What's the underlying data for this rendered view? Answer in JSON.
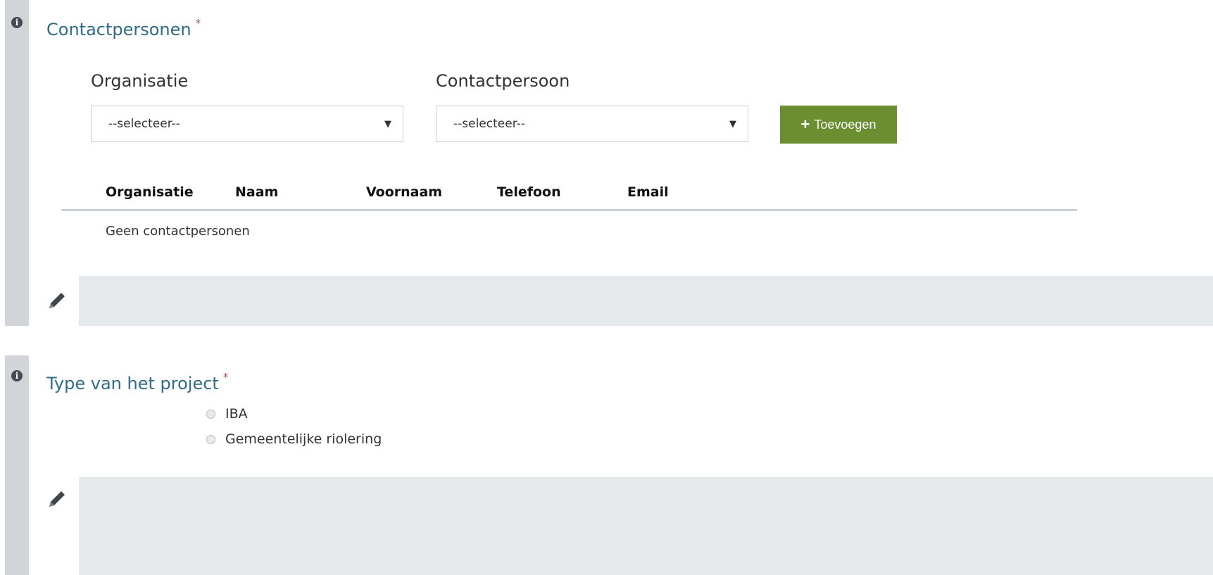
{
  "contacts_section": {
    "title": "Contactpersonen",
    "required_marker": "*",
    "info_icon": "i",
    "organisation_label": "Organisatie",
    "organisation_select_value": "--selecteer--",
    "contact_label": "Contactpersoon",
    "contact_select_value": "--selecteer--",
    "add_button_label": "Toevoegen",
    "table_columns": [
      "Organisatie",
      "Naam",
      "Voornaam",
      "Telefoon",
      "Email"
    ],
    "empty_message": "Geen contactpersonen"
  },
  "project_type_section": {
    "title": "Type van het project",
    "required_marker": "*",
    "info_icon": "i",
    "options": [
      "IBA",
      "Gemeentelijke riolering"
    ]
  },
  "icons": {
    "info": "info-circle-icon",
    "edit": "pencil-icon",
    "add": "plus-icon",
    "dropdown": "caret-down-icon"
  },
  "colors": {
    "title": "#2f6b86",
    "required": "#a05050",
    "add_button": "#6b8e30",
    "gutter": "#d1d5d9",
    "footer_bar": "#e6e9ec"
  }
}
